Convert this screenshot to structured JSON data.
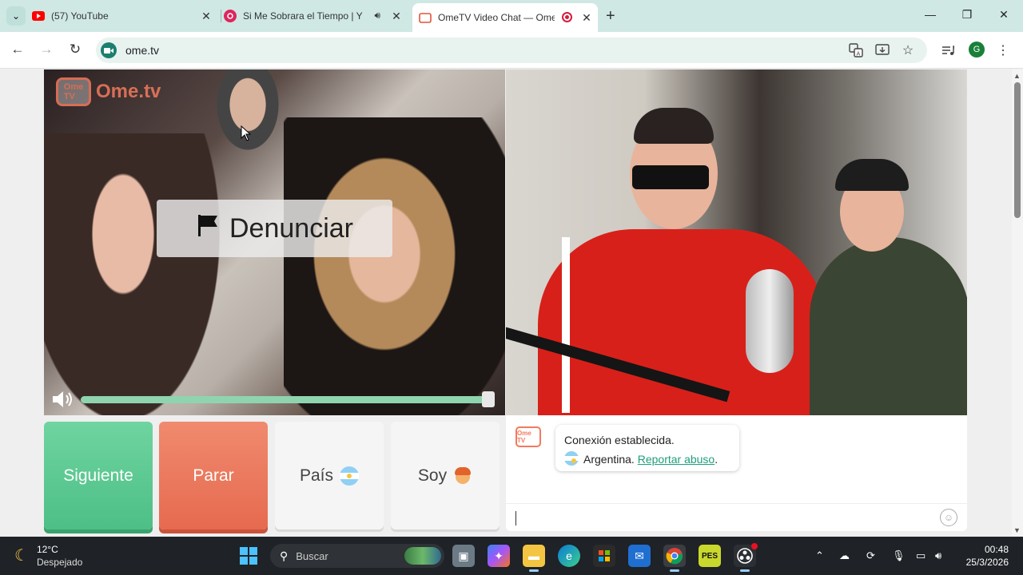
{
  "browser": {
    "tabs": [
      {
        "title": "(57) YouTube",
        "icon": "youtube-icon",
        "active": false
      },
      {
        "title": "Si Me Sobrara el Tiempo | Y",
        "icon": "music-icon",
        "active": false,
        "audio": true
      },
      {
        "title": "OmeTV Video Chat — Ome",
        "icon": "ometv-icon",
        "active": true,
        "recording": true
      }
    ],
    "url": "ome.tv",
    "profile_initial": "G"
  },
  "page": {
    "logo_box_text": "Ome\nTV",
    "logo_brand": "Ome.tv",
    "report_label": "Denunciar",
    "controls": {
      "next": "Siguiente",
      "stop": "Parar",
      "country": "País",
      "gender": "Soy"
    },
    "chat": {
      "avatar_text": "Ome TV",
      "line1": "Conexión establecida.",
      "country": "Argentina.",
      "report_link": "Reportar abuso",
      "trailing": "."
    }
  },
  "taskbar": {
    "temperature": "12°C",
    "condition": "Despejado",
    "search_placeholder": "Buscar",
    "time": "00:48",
    "date": "25/3/2026"
  },
  "colors": {
    "next": "#5cc994",
    "stop": "#ea7558",
    "brand": "#f27a5e",
    "link": "#1e9e7c"
  }
}
